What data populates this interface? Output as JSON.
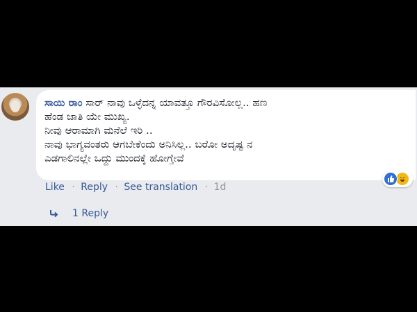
{
  "comment": {
    "author": "ಸಾಯಿ ರಾಂ",
    "text_line1": "ಸಾರ್ ನಾವು ಒಳ್ಳೆದನ್ನ ಯಾವತ್ತೂ ಗೌರವಿಸೋಲ್ಲ.. ಹಣ",
    "text_line2": "ಹೆಂಡ ಜಾತಿ ಯೇ ಮುಖ್ಯ.",
    "text_line3": "ನೀವು ಆರಾಮಾಗಿ ಮನೆಲೆ ಇರಿ ..",
    "text_line4": "ನಾವು ಭಾಗ್ಯವಂತರು ಆಗಬೇಕೆಂದು ಅನಿಸಿಲ್ಲ.. ಬರೋ ಅದೃಷ್ಟ ನ",
    "text_line5": "ಎಡಗಾಲಿನಲ್ಲೇ ಒದ್ದು ಮುಂದಕ್ಕೆ ಹೋಗ್ತೇವೆ"
  },
  "actions": {
    "like": "Like",
    "reply": "Reply",
    "see_translation": "See translation",
    "separator": "·",
    "time": "1d"
  },
  "replies": {
    "label": "1 Reply"
  },
  "reactions": [
    "like-icon",
    "haha-icon"
  ],
  "colors": {
    "link": "#385898",
    "author": "#365899",
    "panel": "#e9ebee",
    "muted": "#90949c"
  }
}
